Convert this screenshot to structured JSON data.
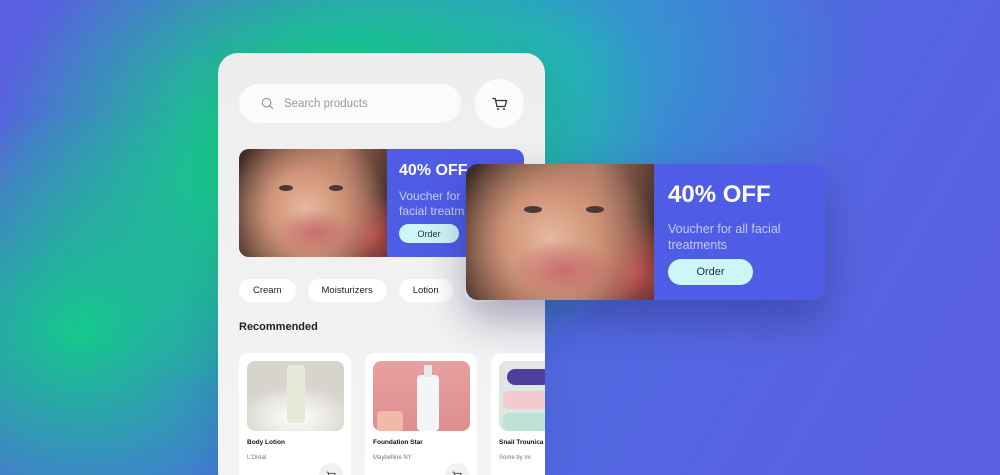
{
  "search": {
    "placeholder": "Search products"
  },
  "promo": {
    "discount": "40% OFF",
    "description_small": "Voucher for\nfacial treatm",
    "description": "Voucher for all facial treatments",
    "button": "Order"
  },
  "categories": [
    "Cream",
    "Moisturizers",
    "Lotion"
  ],
  "section_title": "Recommended",
  "products": [
    {
      "name": "Body Lotion",
      "brand": "L'Oréal"
    },
    {
      "name": "Foundation Star",
      "brand": "Maybelline NY"
    },
    {
      "name": "Snail Trounica",
      "brand": "Some by mi"
    }
  ],
  "colors": {
    "accent": "#4f5ce6",
    "button": "#cdf6f6",
    "green": "#0fd67e"
  },
  "icons": {
    "search": "search-icon",
    "cart": "cart-icon"
  }
}
